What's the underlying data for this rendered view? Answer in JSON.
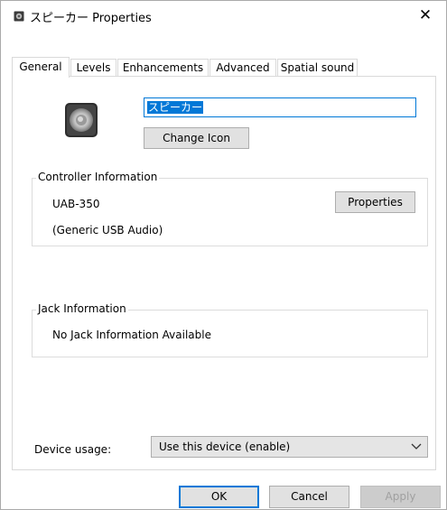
{
  "window": {
    "title": "スピーカー Properties",
    "close_glyph": "✕"
  },
  "tabs": [
    {
      "label": "General"
    },
    {
      "label": "Levels"
    },
    {
      "label": "Enhancements"
    },
    {
      "label": "Advanced"
    },
    {
      "label": "Spatial sound"
    }
  ],
  "general": {
    "device_name": "スピーカー",
    "change_icon_label": "Change Icon",
    "controller": {
      "legend": "Controller Information",
      "name": "UAB-350",
      "driver": "(Generic USB Audio)",
      "properties_label": "Properties"
    },
    "jack": {
      "legend": "Jack Information",
      "text": "No Jack Information Available"
    },
    "usage": {
      "label": "Device usage:",
      "selected": "Use this device (enable)"
    }
  },
  "footer": {
    "ok": "OK",
    "cancel": "Cancel",
    "apply": "Apply"
  },
  "colors": {
    "accent": "#0078d7",
    "button_face": "#e1e1e1",
    "disabled_text": "#a0a0a0"
  }
}
